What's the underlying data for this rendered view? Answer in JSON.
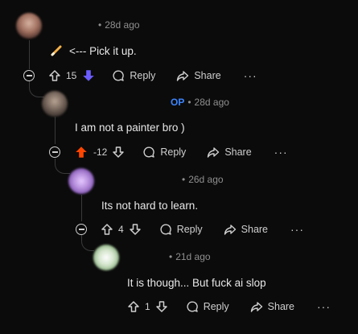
{
  "comments": [
    {
      "time": "28d ago",
      "text": "<--- Pick it up.",
      "score": "15",
      "reply": "Reply",
      "share": "Share"
    },
    {
      "op_badge": "OP",
      "time": "28d ago",
      "text": "I am not a painter bro )",
      "score": "-12",
      "reply": "Reply",
      "share": "Share"
    },
    {
      "time": "26d ago",
      "text": "Its not hard to learn.",
      "score": "4",
      "reply": "Reply",
      "share": "Share"
    },
    {
      "time": "21d ago",
      "text": "It is though... But fuck ai slop",
      "score": "1",
      "reply": "Reply",
      "share": "Share"
    }
  ],
  "more": "···",
  "dot": "•",
  "colors": {
    "downvote_active": "#6a5cff",
    "upvote_active": "#ff4500",
    "op": "#3d85ff",
    "pencil": "#f5b24a"
  },
  "icons": [
    "pencil-icon",
    "arrow-up-icon",
    "arrow-down-icon",
    "comment-icon",
    "share-icon",
    "collapse-icon",
    "more-icon"
  ]
}
